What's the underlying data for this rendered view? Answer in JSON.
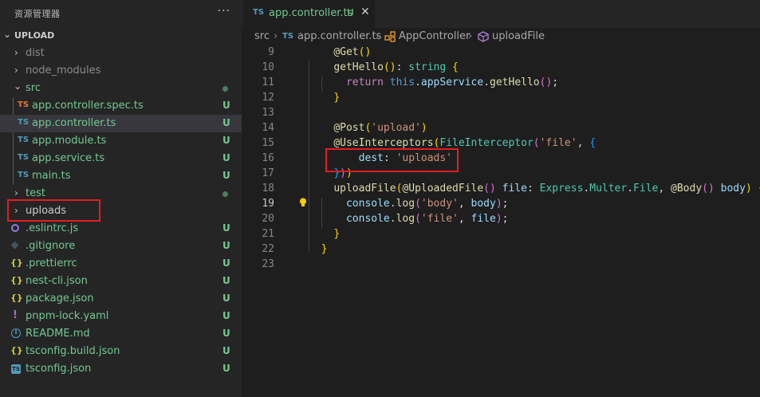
{
  "sidebar": {
    "title": "资源管理器",
    "more": "···",
    "section": "UPLOAD",
    "items": [
      {
        "name": "dist",
        "kind": "folder"
      },
      {
        "name": "node_modules",
        "kind": "folder"
      },
      {
        "name": "src",
        "kind": "folder-open"
      },
      {
        "name": "app.controller.spec.ts",
        "icon": "TS",
        "badge": "U"
      },
      {
        "name": "app.controller.ts",
        "icon": "TS",
        "badge": "U"
      },
      {
        "name": "app.module.ts",
        "icon": "TS",
        "badge": "U"
      },
      {
        "name": "app.service.ts",
        "icon": "TS",
        "badge": "U"
      },
      {
        "name": "main.ts",
        "icon": "TS",
        "badge": "U"
      },
      {
        "name": "test",
        "kind": "folder"
      },
      {
        "name": "uploads",
        "kind": "folder"
      },
      {
        "name": ".eslintrc.js",
        "icon": "eslint-icon",
        "badge": "U"
      },
      {
        "name": ".gitignore",
        "icon": "git-icon",
        "badge": "U"
      },
      {
        "name": ".prettierrc",
        "icon": "{}",
        "badge": "U"
      },
      {
        "name": "nest-cli.json",
        "icon": "{}",
        "badge": "U"
      },
      {
        "name": "package.json",
        "icon": "{}",
        "badge": "U"
      },
      {
        "name": "pnpm-lock.yaml",
        "icon": "!",
        "badge": "U"
      },
      {
        "name": "README.md",
        "icon": "info-icon",
        "badge": "U"
      },
      {
        "name": "tsconfig.build.json",
        "icon": "{}",
        "badge": "U"
      },
      {
        "name": "tsconfig.json",
        "icon": "TS",
        "badge": "U"
      }
    ]
  },
  "tab": {
    "icon": "TS",
    "label": "app.controller.ts",
    "status": "U",
    "close": "✕"
  },
  "breadcrumbs": {
    "part1": "src",
    "file_icon": "TS",
    "part2": "app.controller.ts",
    "part3": "AppController",
    "part4": "uploadFile"
  },
  "editor": {
    "active_line": 19,
    "line_numbers": [
      "9",
      "10",
      "11",
      "12",
      "13",
      "14",
      "15",
      "16",
      "17",
      "18",
      "19",
      "20",
      "21",
      "22",
      "23"
    ]
  },
  "colors": {
    "accent_green": "#73c991",
    "ts_blue": "#519aba",
    "highlight_red": "#e51c23"
  }
}
